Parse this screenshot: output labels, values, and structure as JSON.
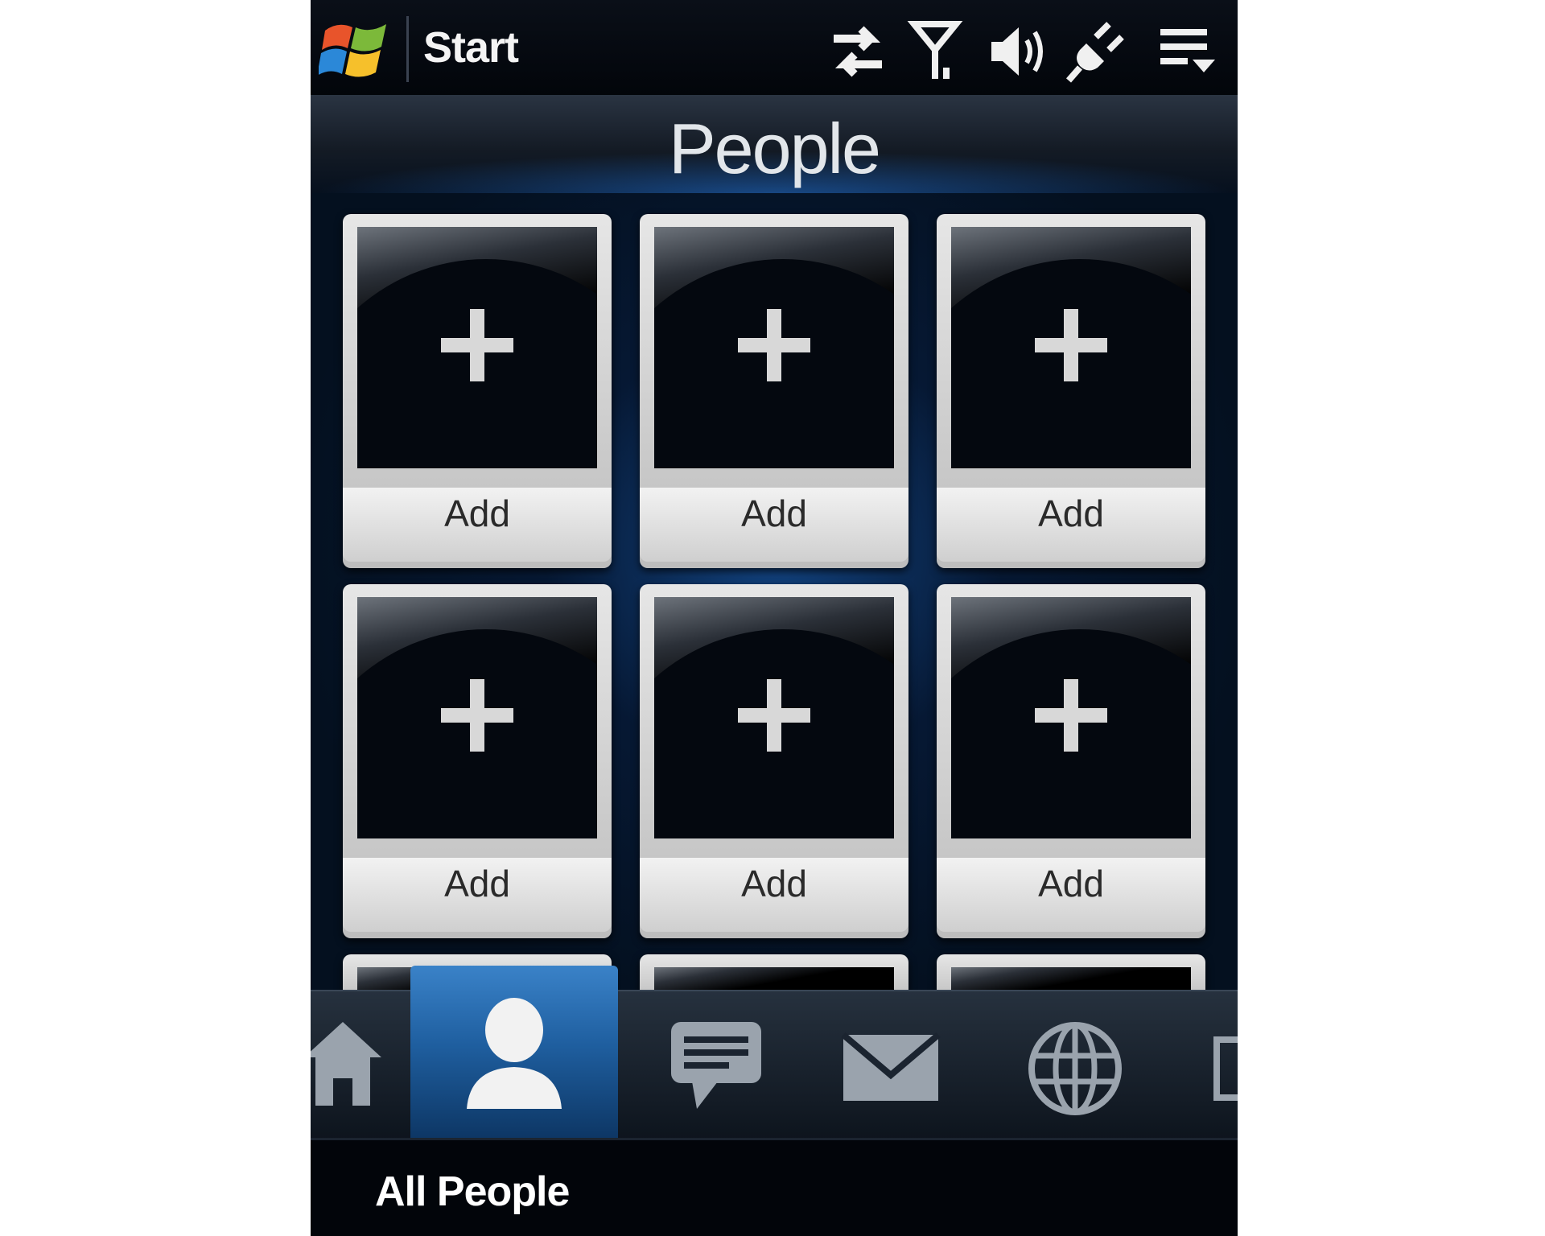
{
  "statusbar": {
    "title": "Start",
    "icons": [
      "windows-logo-icon",
      "sync-arrows-icon",
      "signal-antenna-icon",
      "speaker-volume-icon",
      "power-plug-icon",
      "menu-dropdown-icon"
    ]
  },
  "header": {
    "title": "People"
  },
  "grid": {
    "tiles": [
      {
        "label": "Add",
        "icon": "plus-icon"
      },
      {
        "label": "Add",
        "icon": "plus-icon"
      },
      {
        "label": "Add",
        "icon": "plus-icon"
      },
      {
        "label": "Add",
        "icon": "plus-icon"
      },
      {
        "label": "Add",
        "icon": "plus-icon"
      },
      {
        "label": "Add",
        "icon": "plus-icon"
      }
    ]
  },
  "tabbar": {
    "tabs": [
      {
        "icon": "home-icon",
        "active": false
      },
      {
        "icon": "person-icon",
        "active": true
      },
      {
        "icon": "message-bubble-icon",
        "active": false
      },
      {
        "icon": "envelope-icon",
        "active": false
      },
      {
        "icon": "globe-icon",
        "active": false
      },
      {
        "icon": "partial-tab-icon",
        "active": false
      }
    ]
  },
  "footer": {
    "label": "All People"
  },
  "colors": {
    "accent_blue": "#1f5fa0",
    "background": "#04101f",
    "tile_frame": "#d9d9d9"
  }
}
